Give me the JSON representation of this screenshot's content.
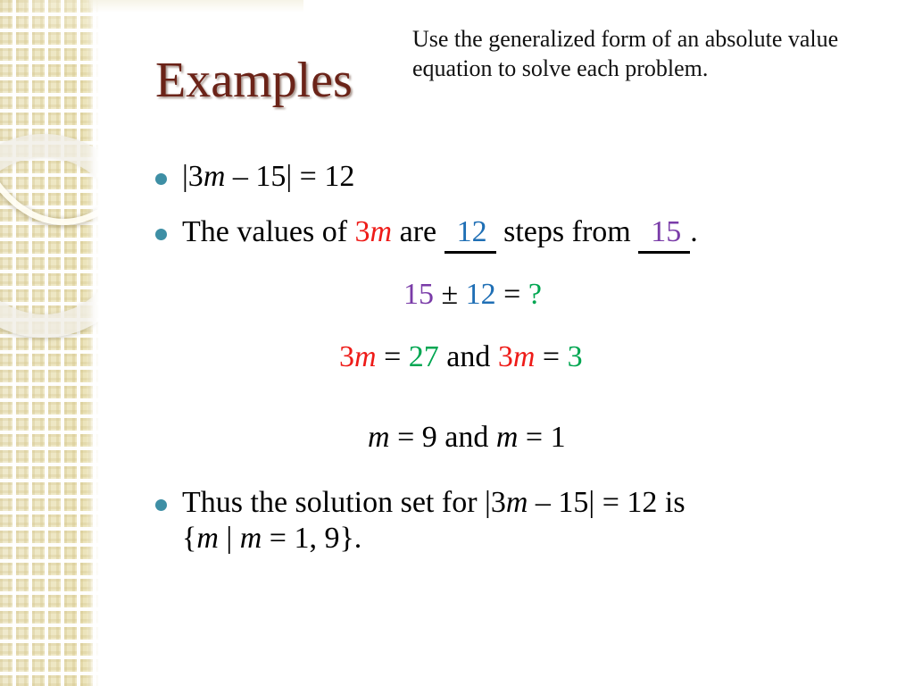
{
  "slide": {
    "title": "Examples",
    "subtitle": "Use the generalized form of an absolute value equation to solve each problem.",
    "bullets": [
      {
        "id": "equation",
        "parts": {
          "prefix": "|3",
          "var": "m",
          "middle": " – 15| = 12"
        },
        "full_text": "|3m – 15| = 12"
      },
      {
        "id": "values-sentence",
        "parts": {
          "lead": "The values of ",
          "coef": "3",
          "var": "m",
          "are": " are ",
          "blank_steps": "12",
          "steps_from": " steps from ",
          "blank_center": "15",
          "period": "."
        },
        "full_text": "The values of 3m are 12 steps from 15 ."
      },
      {
        "id": "solution-set",
        "parts": {
          "lead": "Thus the solution set for |3",
          "var": "m",
          "middle": " – 15| = 12 is",
          "line2_open": "{",
          "line2_var1": "m",
          "line2_pipe": " | ",
          "line2_var2": "m",
          "line2_rest": " = 1, 9}."
        },
        "full_text": "Thus the solution set for |3m – 15| = 12 is {m | m = 1, 9}."
      }
    ],
    "work_lines": [
      {
        "id": "center-plus-minus-distance",
        "tokens": [
          {
            "text": "15",
            "color": "purple"
          },
          {
            "text": " ± ",
            "color": "black"
          },
          {
            "text": "12",
            "color": "blue"
          },
          {
            "text": " = ",
            "color": "black"
          },
          {
            "text": "?",
            "color": "green"
          }
        ],
        "full_text": "15 ± 12 = ?"
      },
      {
        "id": "three-m-results",
        "tokens": [
          {
            "text": "3",
            "color": "red",
            "italic_tail": "m"
          },
          {
            "text": " = ",
            "color": "black"
          },
          {
            "text": "27",
            "color": "green"
          },
          {
            "text": "  and  ",
            "color": "black"
          },
          {
            "text": "3",
            "color": "red",
            "italic_tail": "m"
          },
          {
            "text": " = ",
            "color": "black"
          },
          {
            "text": "3",
            "color": "green"
          }
        ],
        "full_text": "3m = 27  and  3m = 3"
      },
      {
        "id": "m-results",
        "tokens": [
          {
            "text": "m",
            "color": "black",
            "italic": true
          },
          {
            "text": " = 9  and  ",
            "color": "black"
          },
          {
            "text": "m",
            "color": "black",
            "italic": true
          },
          {
            "text": " = 1",
            "color": "black"
          }
        ],
        "full_text": "m = 9  and  m = 1"
      }
    ]
  },
  "colors": {
    "title": "#6b2318",
    "bullet_dot": "#3e8fa5",
    "red": "#ee1b18",
    "blue": "#1f6fb5",
    "purple": "#7a3ca8",
    "green": "#00a651",
    "text": "#000000",
    "sidebar_beige": "#eee7c4",
    "background": "#ffffff"
  },
  "work": {
    "line1": {
      "center": "15",
      "pm": " ± ",
      "distance": "12",
      "eq": " = ",
      "result": "?"
    },
    "line2": {
      "lhs1_coef": "3",
      "lhs1_var": "m",
      "eq1": " = ",
      "rhs1": "27",
      "conj": "  and  ",
      "lhs2_coef": "3",
      "lhs2_var": "m",
      "eq2": " = ",
      "rhs2": "3"
    },
    "line3": {
      "var1": "m",
      "mid": " = 9  and  ",
      "var2": "m",
      "tail": " = 1"
    }
  }
}
